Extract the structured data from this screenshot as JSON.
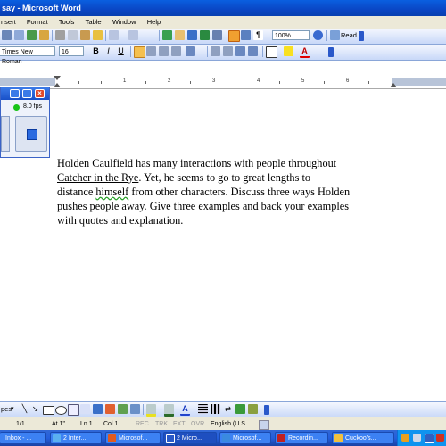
{
  "window": {
    "title": "say - Microsoft Word"
  },
  "menu": [
    "nsert",
    "Format",
    "Tools",
    "Table",
    "Window",
    "Help"
  ],
  "toolbar": {
    "zoom": "100%",
    "read_label": "Read",
    "font_name": "Times New Roman",
    "font_size": "16"
  },
  "widget": {
    "fps": "8.0 fps"
  },
  "document": {
    "line1": "Holden Caulfield has many interactions with people throughout",
    "book_title": "Catcher in the Rye",
    "line2_rest": ".  Yet, he seems to go to great lengths to",
    "line3_a": "distance ",
    "line3_word": "himself",
    "line3_b": " from other characters.  Discuss three ways Holden",
    "line4": "pushes people away.  Give three examples and back your examples",
    "line5": "with quotes and explanation."
  },
  "drawing_toolbar": {
    "label": "pes"
  },
  "status": {
    "page": "1/1",
    "at": "At  1\"",
    "ln": "Ln  1",
    "col": "Col  1",
    "rec": "REC",
    "trk": "TRK",
    "ext": "EXT",
    "ovr": "OVR",
    "lang": "English (U.S"
  },
  "taskbar": {
    "items": [
      {
        "label": "Inbox - ..."
      },
      {
        "label": "2 Inter..."
      },
      {
        "label": "Microsof..."
      },
      {
        "label": "2 Micro..."
      },
      {
        "label": "Microsof..."
      },
      {
        "label": "Recordin..."
      },
      {
        "label": "Cuckoo's..."
      }
    ]
  },
  "colors": {
    "title_blue": "#0a46c4",
    "taskbar_blue": "#245edb",
    "tray_blue": "#0f93ef"
  }
}
